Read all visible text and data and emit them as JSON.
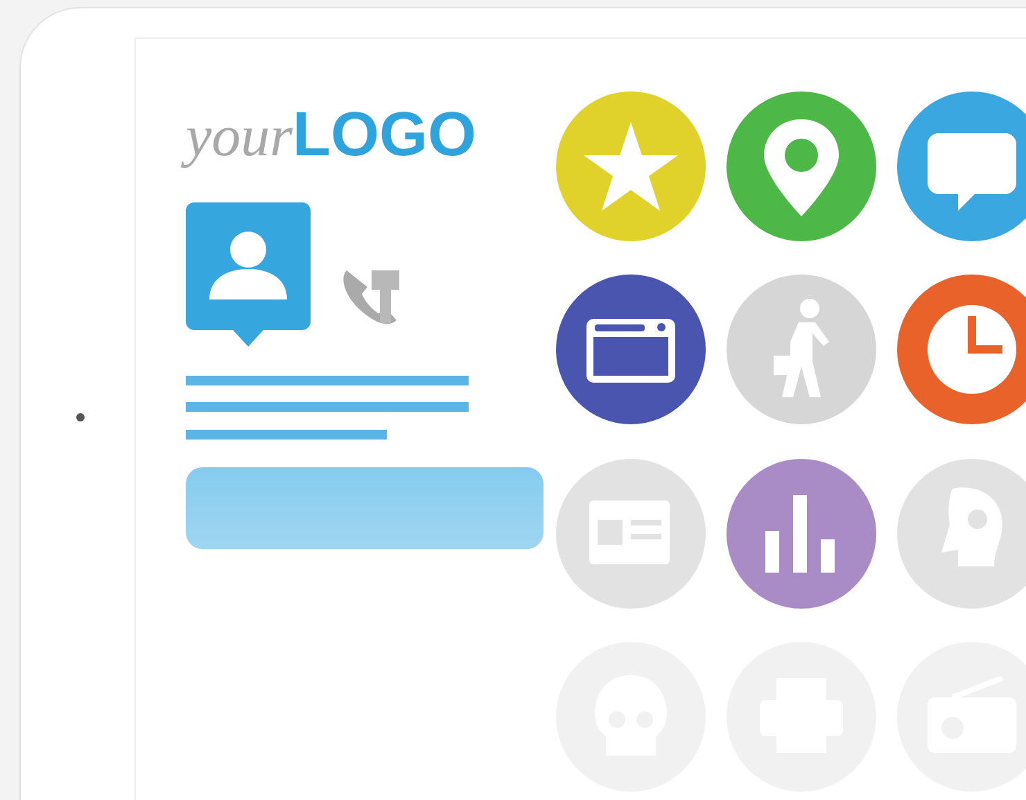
{
  "logo": {
    "prefix": "your",
    "name": "LOGO"
  },
  "tiles": [
    {
      "kind": "star",
      "color": "#e0d22a"
    },
    {
      "kind": "pin",
      "color": "#4db848"
    },
    {
      "kind": "chat",
      "color": "#3aa7e0"
    },
    {
      "kind": "window",
      "color": "#4a55b0"
    },
    {
      "kind": "walker",
      "color": "#d6d6d6"
    },
    {
      "kind": "clock",
      "color": "#e8622a"
    },
    {
      "kind": "news",
      "color": "#e2e2e2"
    },
    {
      "kind": "bars",
      "color": "#a98cc6"
    },
    {
      "kind": "head",
      "color": "#e2e2e2"
    },
    {
      "kind": "skull",
      "color": "#f1f1f1"
    },
    {
      "kind": "printer",
      "color": "#f1f1f1"
    },
    {
      "kind": "radio",
      "color": "#f1f1f1"
    }
  ]
}
